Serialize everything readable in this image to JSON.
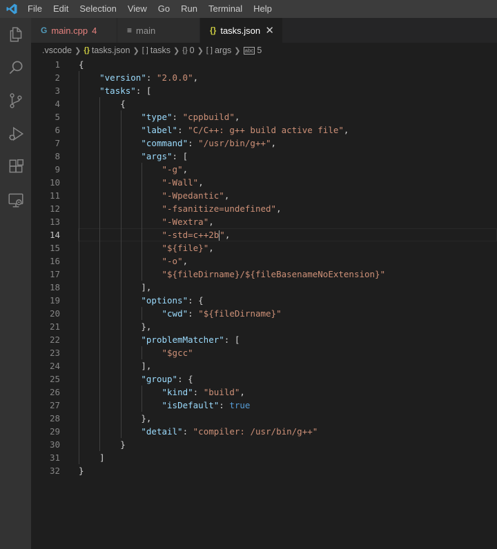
{
  "menu": [
    "File",
    "Edit",
    "Selection",
    "View",
    "Go",
    "Run",
    "Terminal",
    "Help"
  ],
  "activity_icons": [
    "explorer-icon",
    "search-icon",
    "source-control-icon",
    "run-debug-icon",
    "extensions-icon",
    "remote-explorer-icon"
  ],
  "tabs": [
    {
      "label": "main.cpp",
      "badge": "4",
      "icon": "C++ file icon"
    },
    {
      "label": "main",
      "icon": "text file icon"
    },
    {
      "label": "tasks.json",
      "icon": "{}",
      "close": "✕",
      "active": true
    }
  ],
  "breadcrumb": {
    "folder": ".vscode",
    "file_icon": "{}",
    "file": "tasks.json",
    "array_icon": "[ ]",
    "tasks": "tasks",
    "obj_icon": "{}",
    "index": "0",
    "args": "args",
    "item": "5"
  },
  "editor": {
    "current_line": 14,
    "lines": [
      "{",
      "    \"version\": \"2.0.0\",",
      "    \"tasks\": [",
      "        {",
      "            \"type\": \"cppbuild\",",
      "            \"label\": \"C/C++: g++ build active file\",",
      "            \"command\": \"/usr/bin/g++\",",
      "            \"args\": [",
      "                \"-g\",",
      "                \"-Wall\",",
      "                \"-Wpedantic\",",
      "                \"-fsanitize=undefined\",",
      "                \"-Wextra\",",
      "                \"-std=c++2b\",",
      "                \"${file}\",",
      "                \"-o\",",
      "                \"${fileDirname}/${fileBasenameNoExtension}\"",
      "            ],",
      "            \"options\": {",
      "                \"cwd\": \"${fileDirname}\"",
      "            },",
      "            \"problemMatcher\": [",
      "                \"$gcc\"",
      "            ],",
      "            \"group\": {",
      "                \"kind\": \"build\",",
      "                \"isDefault\": true",
      "            },",
      "            \"detail\": \"compiler: /usr/bin/g++\"",
      "        }",
      "    ]",
      "}"
    ]
  },
  "colors": {
    "key": "#9cdcfe",
    "string": "#ce9178",
    "boolean": "#569cd6",
    "punctuation": "#d4d4d4",
    "line_number": "#858585"
  }
}
